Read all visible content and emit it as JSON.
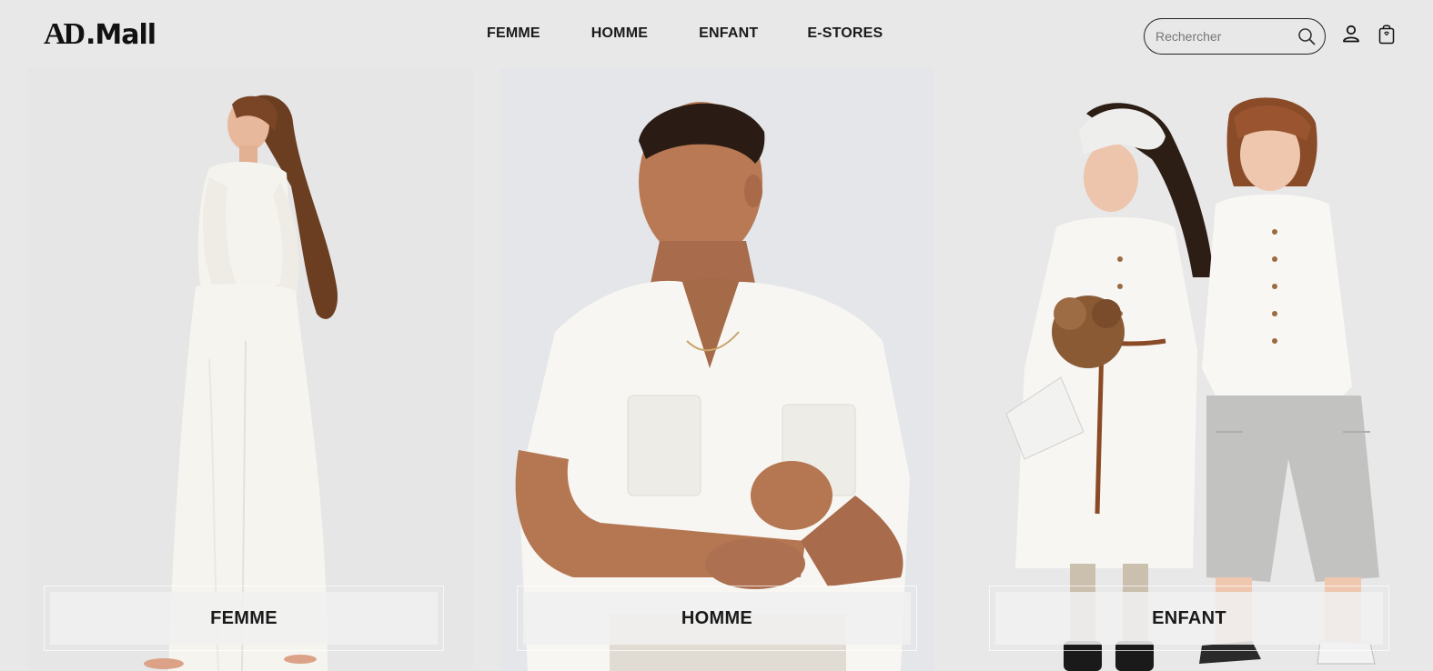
{
  "brand": {
    "logo_text": "AD.Mall"
  },
  "nav": {
    "items": [
      {
        "label": "FEMME"
      },
      {
        "label": "HOMME"
      },
      {
        "label": "ENFANT"
      },
      {
        "label": "E-STORES"
      }
    ]
  },
  "search": {
    "placeholder": "Rechercher",
    "value": ""
  },
  "icons": {
    "search": "search-icon",
    "account": "user-icon",
    "cart": "shopping-bag-icon"
  },
  "categories": [
    {
      "label": "FEMME"
    },
    {
      "label": "HOMME"
    },
    {
      "label": "ENFANT"
    }
  ],
  "colors": {
    "background": "#e8e8e8",
    "text": "#1a1a1a"
  }
}
